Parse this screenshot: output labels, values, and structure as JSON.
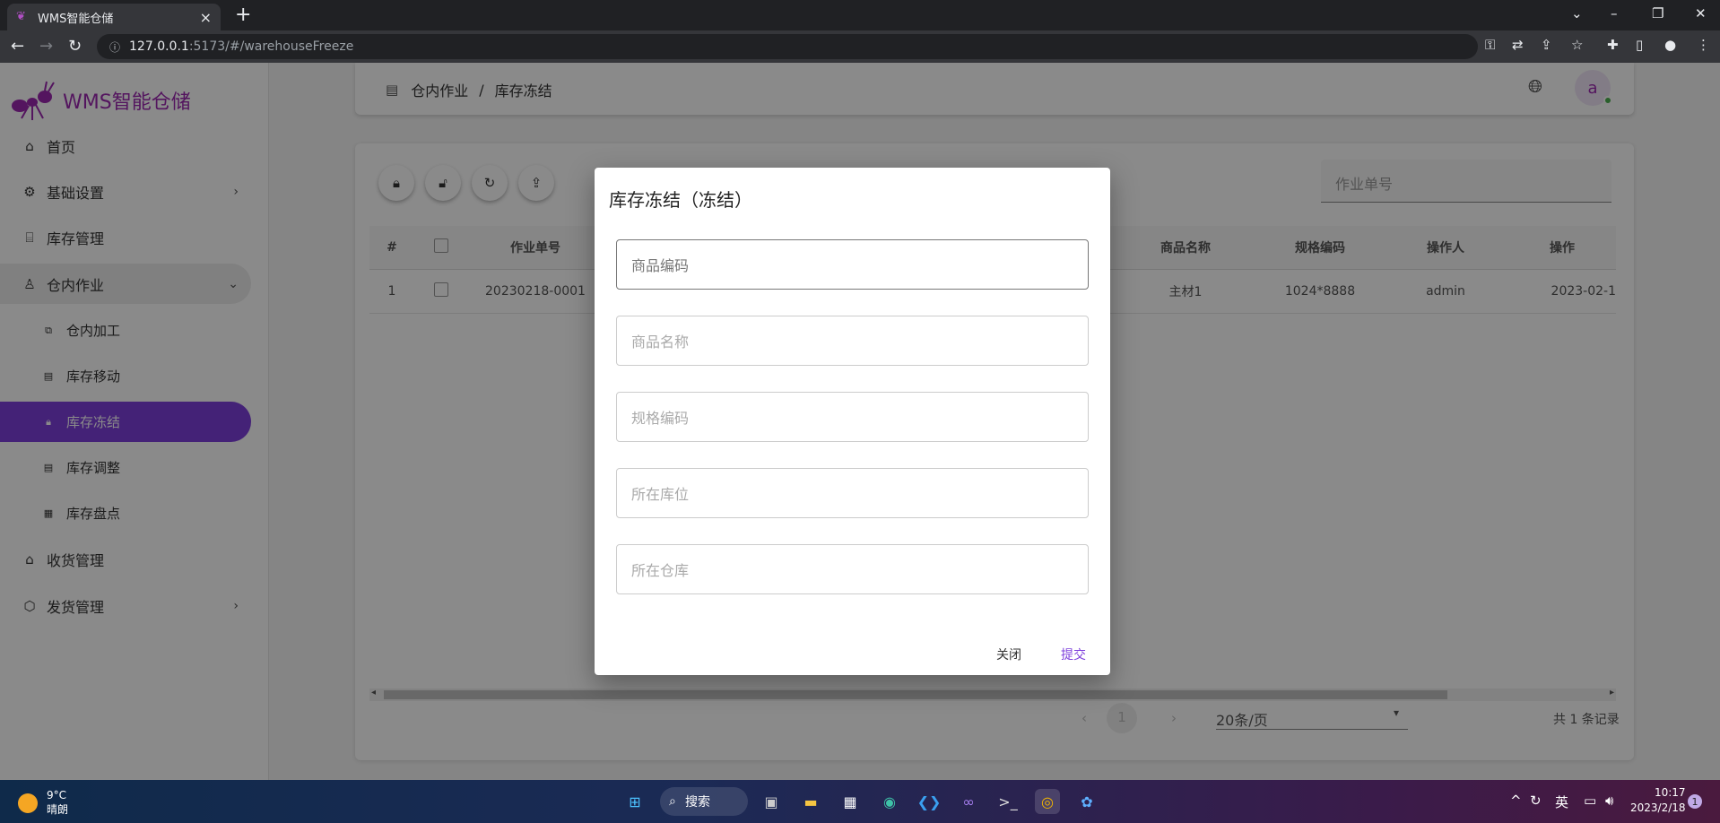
{
  "browser": {
    "tab_title": "WMS智能仓储",
    "tab_close": "×",
    "new_tab": "+",
    "url_host": "127.0.0.1",
    "url_path": ":5173/#/warehouseFreeze"
  },
  "app": {
    "logo_text": "WMS智能仓储",
    "brand_color": "#9c27b0",
    "active_color": "#7e3fdc"
  },
  "sidebar": {
    "items": [
      {
        "label": "首页",
        "icon": "home-icon"
      },
      {
        "label": "基础设置",
        "icon": "gear-icon"
      },
      {
        "label": "库存管理",
        "icon": "warehouse-icon"
      },
      {
        "label": "仓内作业",
        "icon": "person-icon"
      },
      {
        "label": "仓内加工",
        "icon": "copy-icon"
      },
      {
        "label": "库存移动",
        "icon": "file-move-icon"
      },
      {
        "label": "库存冻结",
        "icon": "lock-icon"
      },
      {
        "label": "库存调整",
        "icon": "file-adjust-icon"
      },
      {
        "label": "库存盘点",
        "icon": "list-icon"
      },
      {
        "label": "收货管理",
        "icon": "receive-icon"
      },
      {
        "label": "发货管理",
        "icon": "ship-icon"
      }
    ]
  },
  "header": {
    "breadcrumb_parent": "仓内作业",
    "breadcrumb_sep": "/",
    "breadcrumb_current": "库存冻结",
    "avatar_letter": "a"
  },
  "toolbar": {
    "search_placeholder": "作业单号"
  },
  "table": {
    "headers": [
      "#",
      "",
      "作业单号",
      "商品名称",
      "规格编码",
      "操作人",
      "操作"
    ],
    "rows": [
      [
        "1",
        "",
        "20230218-0001",
        "主材1",
        "1024*8888",
        "admin",
        "2023-02-1"
      ]
    ]
  },
  "pagination": {
    "current_page": "1",
    "page_size": "20条/页",
    "total_text": "共 1 条记录"
  },
  "dialog": {
    "title": "库存冻结（冻结）",
    "fields": [
      "商品编码",
      "商品名称",
      "规格编码",
      "所在库位",
      "所在仓库"
    ],
    "close_label": "关闭",
    "submit_label": "提交"
  },
  "taskbar": {
    "temp": "9°C",
    "weather": "晴朗",
    "search_label": "搜索",
    "ime": "英",
    "time": "10:17",
    "date": "2023/2/18",
    "notification_count": "1"
  }
}
